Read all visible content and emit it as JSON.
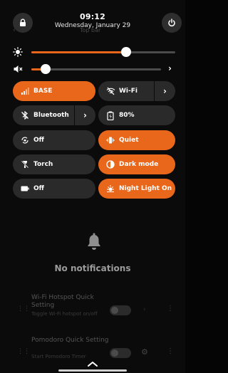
{
  "status": {
    "time": "09:12",
    "date": "Wednesday, January 29",
    "ghost_title": "Top bar",
    "lock_icon": "lock-icon",
    "power_icon": "power-icon"
  },
  "sliders": {
    "brightness": {
      "level": 0.66,
      "icon": "brightness-icon"
    },
    "volume": {
      "level": 0.11,
      "icon": "volume-muted-icon"
    }
  },
  "tiles": {
    "mobile": {
      "label": "BASE",
      "active": true
    },
    "wifi": {
      "label": "Wi-Fi",
      "active": false
    },
    "bluetooth": {
      "label": "Bluetooth",
      "active": false
    },
    "battery": {
      "label": "80%",
      "active": false
    },
    "rotation": {
      "label": "Off",
      "active": false
    },
    "quiet": {
      "label": "Quiet",
      "active": true
    },
    "torch": {
      "label": "Torch",
      "active": false
    },
    "dark_mode": {
      "label": "Dark mode",
      "active": true
    },
    "power_save": {
      "label": "Off",
      "active": false
    },
    "night_light": {
      "label": "Night Light On",
      "active": true
    }
  },
  "notifications": {
    "empty_text": "No notifications"
  },
  "background_list": [
    {
      "name": "Wi-Fi Hotspot Quick Setting",
      "subtitle": "Toggle Wi-Fi hotspot on/off"
    },
    {
      "name": "Pomodoro Quick Setting",
      "subtitle": "Start Pomodoro Timer"
    }
  ],
  "colors": {
    "accent": "#e8671a",
    "tile_off": "#2a2a2a",
    "background": "#0b0b0b"
  }
}
